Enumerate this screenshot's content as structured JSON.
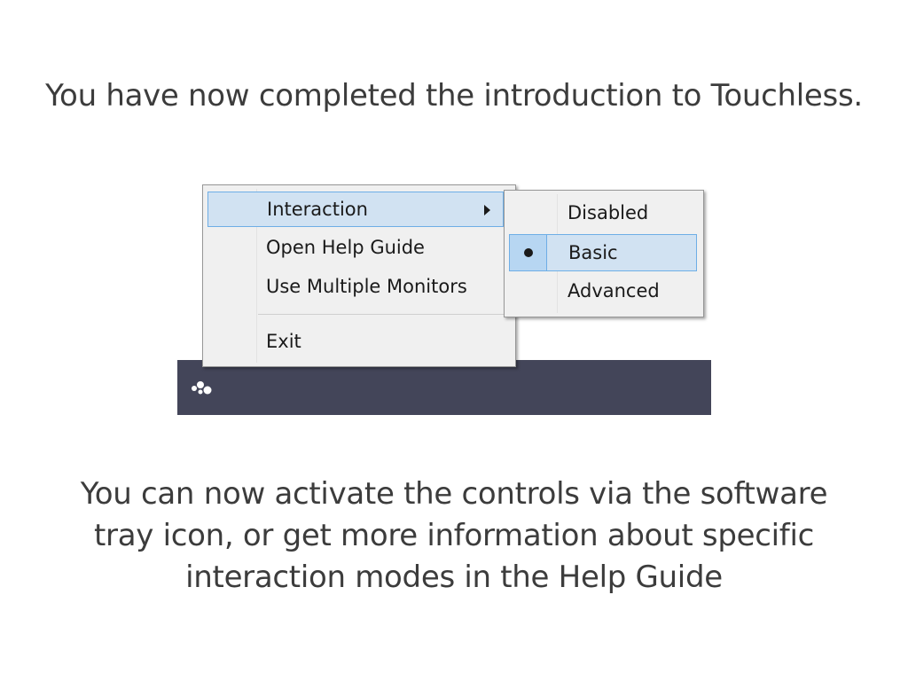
{
  "heading": "You have now completed the introduction to Touchless.",
  "footer": {
    "line1": "You can now activate the controls via the software",
    "line2": "tray icon, or get more information about specific",
    "line3": "interaction modes in the Help Guide"
  },
  "context_menu": {
    "items": [
      {
        "label": "Interaction",
        "has_submenu": true,
        "highlighted": true
      },
      {
        "label": "Open Help Guide"
      },
      {
        "label": "Use Multiple Monitors"
      },
      {
        "label": "Exit"
      }
    ]
  },
  "interaction_submenu": {
    "items": [
      {
        "label": "Disabled"
      },
      {
        "label": "Basic",
        "selected": true,
        "highlighted": true
      },
      {
        "label": "Advanced"
      }
    ]
  },
  "taskbar": {
    "tray_icon": "touchless-tray-icon"
  },
  "colors": {
    "taskbar": "#434559",
    "menu_background": "#f0f0f0",
    "highlight": "#d1e2f2",
    "highlight_border": "#6eaee6",
    "text": "#3c3c3c"
  }
}
